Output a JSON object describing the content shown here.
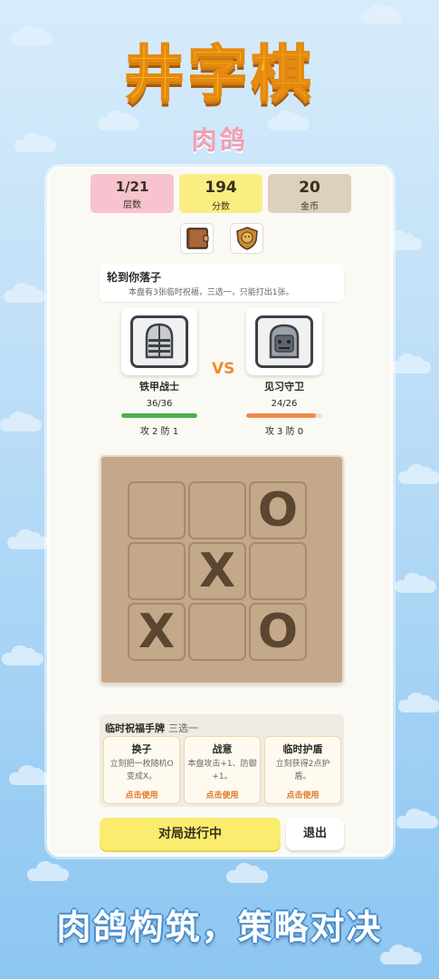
{
  "header": {
    "title": "井字棋",
    "subtitle": "肉鸽"
  },
  "stats": [
    {
      "value": "1/21",
      "label": "层数"
    },
    {
      "value": "194",
      "label": "分数"
    },
    {
      "value": "20",
      "label": "金币"
    }
  ],
  "icons": {
    "book": "book-icon",
    "shield": "lion-shield-icon"
  },
  "turn": {
    "title": "轮到你落子",
    "desc": "本盘有3张临时祝福，三选一，只能打出1张。"
  },
  "vs": "VS",
  "player": {
    "name": "铁甲战士",
    "hp": "36/36",
    "hp_fraction": 1.0,
    "stats": "攻 2  防 1",
    "bar_color": "#4caf50"
  },
  "enemy": {
    "name": "见习守卫",
    "hp": "24/26",
    "hp_fraction": 0.92,
    "stats": "攻 3  防 0",
    "bar_color": "#f08a4b"
  },
  "board": {
    "cells": [
      "",
      "",
      "O",
      "",
      "X",
      "",
      "X",
      "",
      "O"
    ]
  },
  "hand": {
    "title": "临时祝福手牌",
    "subtitle": "三选一",
    "cards": [
      {
        "name": "换子",
        "effect": "立刻把一枚随机O变成X。",
        "action": "点击使用"
      },
      {
        "name": "战意",
        "effect": "本盘攻击+1、防御+1。",
        "action": "点击使用"
      },
      {
        "name": "临时护盾",
        "effect": "立刻获得2点护盾。",
        "action": "点击使用"
      }
    ]
  },
  "footer": {
    "status": "对局进行中",
    "exit": "退出"
  },
  "slogan": "肉鸽构筑，策略对决",
  "colors": {
    "title": "#ffb41e",
    "subtitle": "#ee9fb4",
    "vs": "#f08a2c",
    "status_bg": "#faec6e"
  }
}
